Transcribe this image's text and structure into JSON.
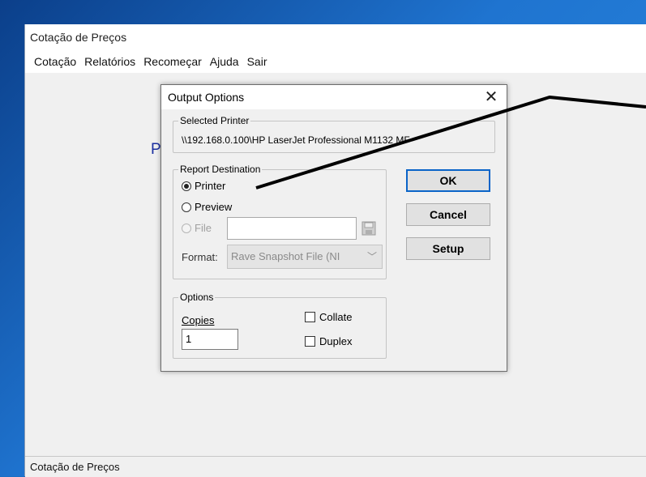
{
  "app": {
    "title": "Cotação de Preços",
    "menu": [
      "Cotação",
      "Relatórios",
      "Recomeçar",
      "Ajuda",
      "Sair"
    ],
    "status": "Cotação de Preços",
    "background_letter": "P"
  },
  "dialog": {
    "title": "Output Options",
    "close_glyph": "✕",
    "selected_printer": {
      "legend": "Selected Printer",
      "name": "\\\\192.168.0.100\\HP LaserJet Professional M1132 MF"
    },
    "report_destination": {
      "legend": "Report Destination",
      "printer_label": "Printer",
      "preview_label": "Preview",
      "file_label": "File",
      "file_value": "",
      "format_label": "Format:",
      "format_value": "Rave Snapshot File (NI",
      "selected": "Printer"
    },
    "buttons": {
      "ok": "OK",
      "cancel": "Cancel",
      "setup": "Setup"
    },
    "options": {
      "legend": "Options",
      "copies_label": "Copies",
      "copies_value": "1",
      "collate_label": "Collate",
      "collate_checked": false,
      "duplex_label": "Duplex",
      "duplex_checked": false
    }
  },
  "icons": {
    "file_browse": "floppy-disk-icon",
    "format_dropdown": "chevron-down-icon"
  },
  "colors": {
    "accent": "#0a64c8",
    "annotation": "#000000"
  }
}
